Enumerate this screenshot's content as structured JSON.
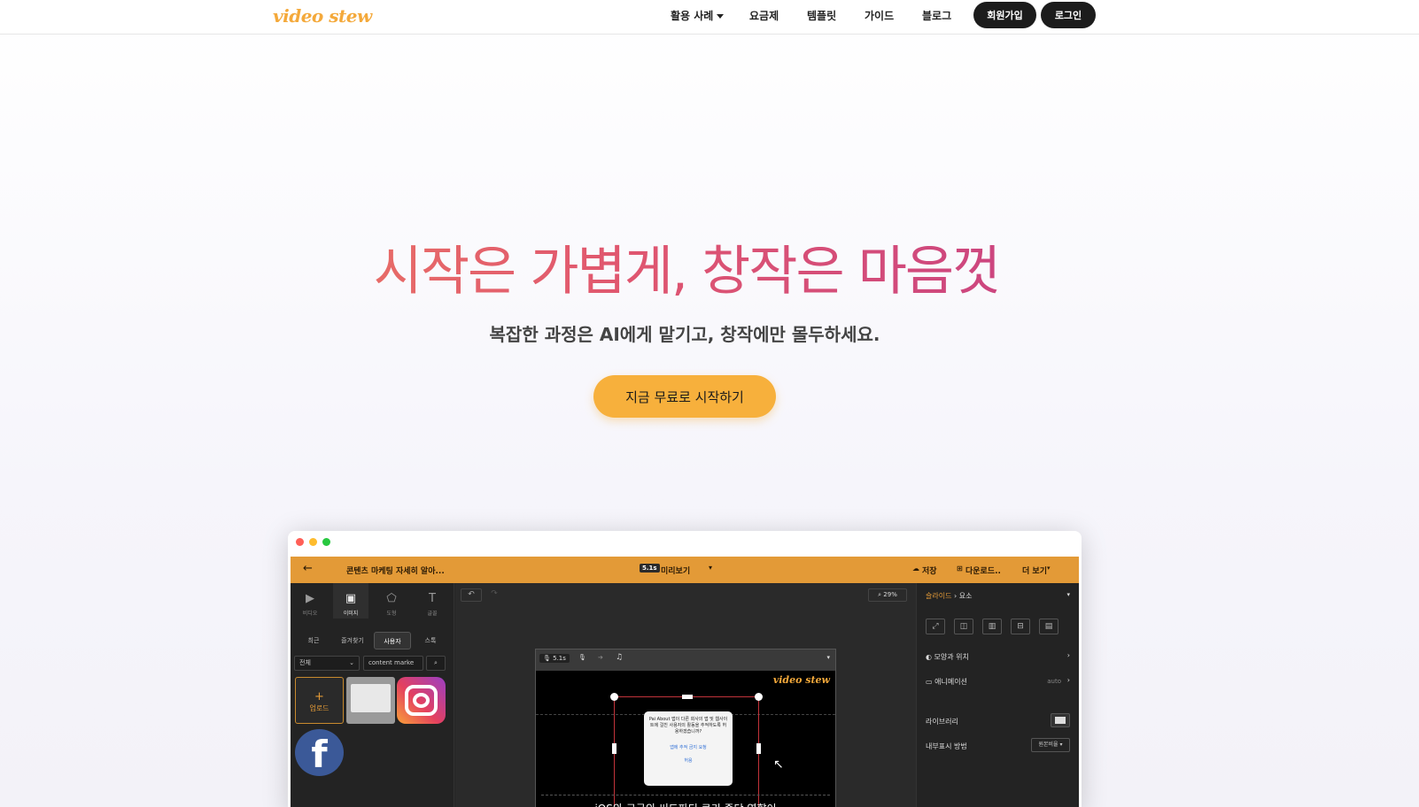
{
  "header": {
    "logo": "video stew",
    "nav": [
      {
        "label": "활용 사례",
        "has_dropdown": true
      },
      {
        "label": "요금제"
      },
      {
        "label": "템플릿"
      },
      {
        "label": "가이드"
      },
      {
        "label": "블로그"
      }
    ],
    "signup_label": "회원가입",
    "login_label": "로그인"
  },
  "hero": {
    "title": "시작은 가볍게, 창작은 마음껏",
    "subtitle": "복잡한 과정은 AI에게 맡기고, 창작에만 몰두하세요.",
    "cta_label": "지금 무료로 시작하기"
  },
  "app": {
    "window_dots": [
      "#ff5f57",
      "#febc2e",
      "#28c840"
    ],
    "top_bar": {
      "back_icon": "arrow-left-icon",
      "project_title": "콘텐츠 마케팅 자세히 알아...",
      "duration_badge": "5.1s",
      "preview_label": "미리보기",
      "save_label": "저장",
      "download_label": "다운로드..",
      "more_label": "더 보기"
    },
    "left_tools": [
      {
        "label": "비디오",
        "icon": "video-icon"
      },
      {
        "label": "이미지",
        "icon": "image-icon",
        "active": true
      },
      {
        "label": "도형",
        "icon": "shape-icon"
      },
      {
        "label": "글꼴",
        "icon": "text-icon"
      }
    ],
    "image_tabs": [
      {
        "label": "최근"
      },
      {
        "label": "즐겨찾기"
      },
      {
        "label": "사용자",
        "active": true
      },
      {
        "label": "스톡"
      }
    ],
    "filter_value": "전체",
    "search_value": "content marke",
    "upload_label": "업로드",
    "zoom_label": "29%",
    "preview_duration": "5.1s",
    "preview_logo": "video stew",
    "dialog_text": "Pai About 앱이 다른 회사의 앱 및 웹사이트에 걸친 사용자의 활동을 추적하도록 허용하겠습니까?",
    "dialog_button_1": "앱에 추적 금지 요청",
    "dialog_button_2": "허용",
    "caption_text": "iOS와 구글의 써드파티 쿠키 중단 영향이",
    "right_panel": {
      "breadcrumb_slide": "슬라이드",
      "breadcrumb_element": "요소",
      "shape_position_label": "모양과 위치",
      "animation_label": "애니메이션",
      "animation_value": "auto",
      "library_label": "라이브러리",
      "display_method_label": "내부표시 방법",
      "display_method_value": "원본비율"
    }
  },
  "colors": {
    "accent": "#f7b03c",
    "brand_logo": "#f4a93b",
    "app_header": "#e39a37"
  }
}
